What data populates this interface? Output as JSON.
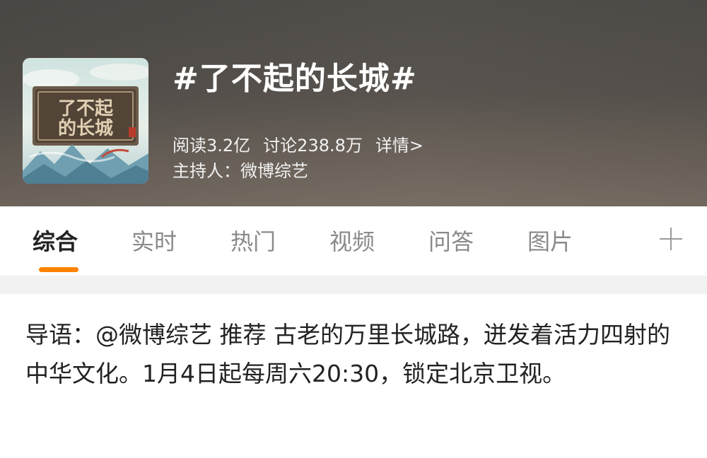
{
  "topic": {
    "title": "#了不起的长城#",
    "reads": "阅读3.2亿",
    "discussions": "讨论238.8万",
    "details": "详情>",
    "host": "主持人：微博综艺",
    "cover_text": "了不起的长城"
  },
  "tabs": [
    {
      "label": "综合",
      "active": true
    },
    {
      "label": "实时",
      "active": false
    },
    {
      "label": "热门",
      "active": false
    },
    {
      "label": "视频",
      "active": false
    },
    {
      "label": "问答",
      "active": false
    },
    {
      "label": "图片",
      "active": false
    }
  ],
  "accent_color": "#ff8200",
  "lead": {
    "text": "导语：@微博综艺 推荐 古老的万里长城路，迸发着活力四射的中华文化。1月4日起每周六20:30，锁定北京卫视。"
  }
}
